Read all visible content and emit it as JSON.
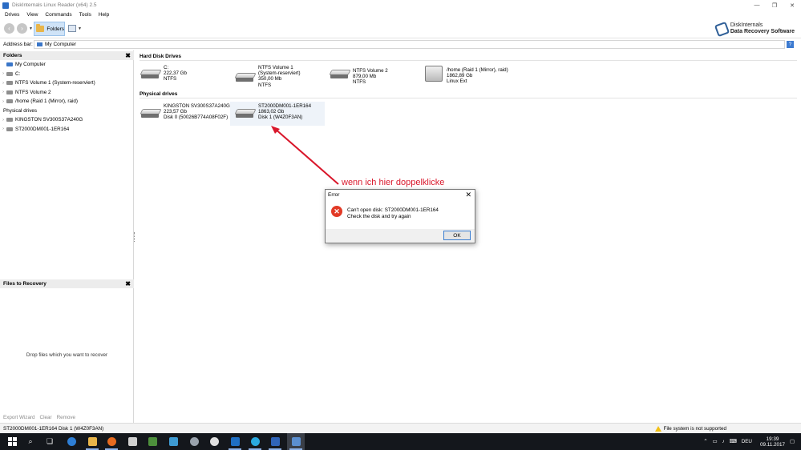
{
  "window": {
    "title": "DiskInternals Linux Reader (x64) 2.5",
    "controls": [
      "—",
      "❐",
      "✕"
    ]
  },
  "menu": [
    "Drives",
    "View",
    "Commands",
    "Tools",
    "Help"
  ],
  "toolbar": {
    "back_icon": "back-arrow-icon",
    "forward_icon": "forward-arrow-icon",
    "folders_label": "Folders",
    "logo_line1": "DiskInternals",
    "logo_line2": "Data Recovery Software"
  },
  "address": {
    "label": "Address bar:",
    "value": "My Computer",
    "help": "?"
  },
  "folders_panel": {
    "title": "Folders",
    "close": "✖",
    "items": [
      {
        "label": "My Computer",
        "caret": ""
      },
      {
        "label": "C:",
        "caret": "›"
      },
      {
        "label": "NTFS Volume 1 (System-reserviert)",
        "caret": "›"
      },
      {
        "label": "NTFS Volume 2",
        "caret": "›"
      },
      {
        "label": "/home (Raid 1 (Mirror), raid)",
        "caret": "›"
      },
      {
        "label": "Physical drives",
        "caret": ""
      },
      {
        "label": "KINGSTON SV300S37A240G",
        "caret": "›"
      },
      {
        "label": "ST2000DM001-1ER164",
        "caret": "›"
      }
    ]
  },
  "recovery_panel": {
    "title": "Files to Recovery",
    "close": "✖",
    "drop_text": "Drop files which you want to recover",
    "actions": [
      "Export Wizard",
      "Clear",
      "Remove"
    ]
  },
  "main": {
    "hard_disk_heading": "Hard Disk Drives",
    "physical_heading": "Physical drives",
    "hard_disks": [
      {
        "line1": "C:",
        "line2": "222,37 Gb",
        "line3": "NTFS",
        "line4": ""
      },
      {
        "line1": "NTFS Volume 1",
        "line2": "(System-reserviert)",
        "line3": "350,00 Mb",
        "line4": "NTFS"
      },
      {
        "line1": "NTFS Volume 2",
        "line2": "879,00 Mb",
        "line3": "NTFS",
        "line4": ""
      },
      {
        "line1": "/home (Raid 1 (Mirror), raid)",
        "line2": "1862,89 Gb",
        "line3": "Linux Ext",
        "line4": ""
      }
    ],
    "physical_drives": [
      {
        "line1": "KINGSTON SV300S37A240G",
        "line2": "223,57 Gb",
        "line3": "Disk 0 (50026B774A08F02F)"
      },
      {
        "line1": "ST2000DM001-1ER164",
        "line2": "1863,02 Gb",
        "line3": "Disk 1 (W4Z0F3AN)"
      }
    ]
  },
  "annotation": {
    "text": "wenn ich hier doppelklicke",
    "color": "#d9172b"
  },
  "dialog": {
    "title": "Error",
    "close": "✕",
    "icon": "error-x-icon",
    "message_line1": "Can't open disk: ST2000DM001-1ER164",
    "message_line2": "Check the disk and try again",
    "ok_label": "OK"
  },
  "status": {
    "left": "ST2000DM001-1ER164 Disk 1 (W4Z0F3AN)",
    "right": "File system is not supported"
  },
  "taskbar": {
    "start_icon": "windows-start-icon",
    "search_icon": "search-icon",
    "apps": [
      "task-view-icon",
      "edge-icon",
      "file-explorer-icon",
      "firefox-icon",
      "calculator-icon",
      "app-icon",
      "app-icon",
      "app-icon",
      "outlook-icon",
      "app-icon",
      "app-icon",
      "linux-reader-icon"
    ],
    "language": "DEU",
    "time": "19:39",
    "date": "09.11.2017"
  }
}
